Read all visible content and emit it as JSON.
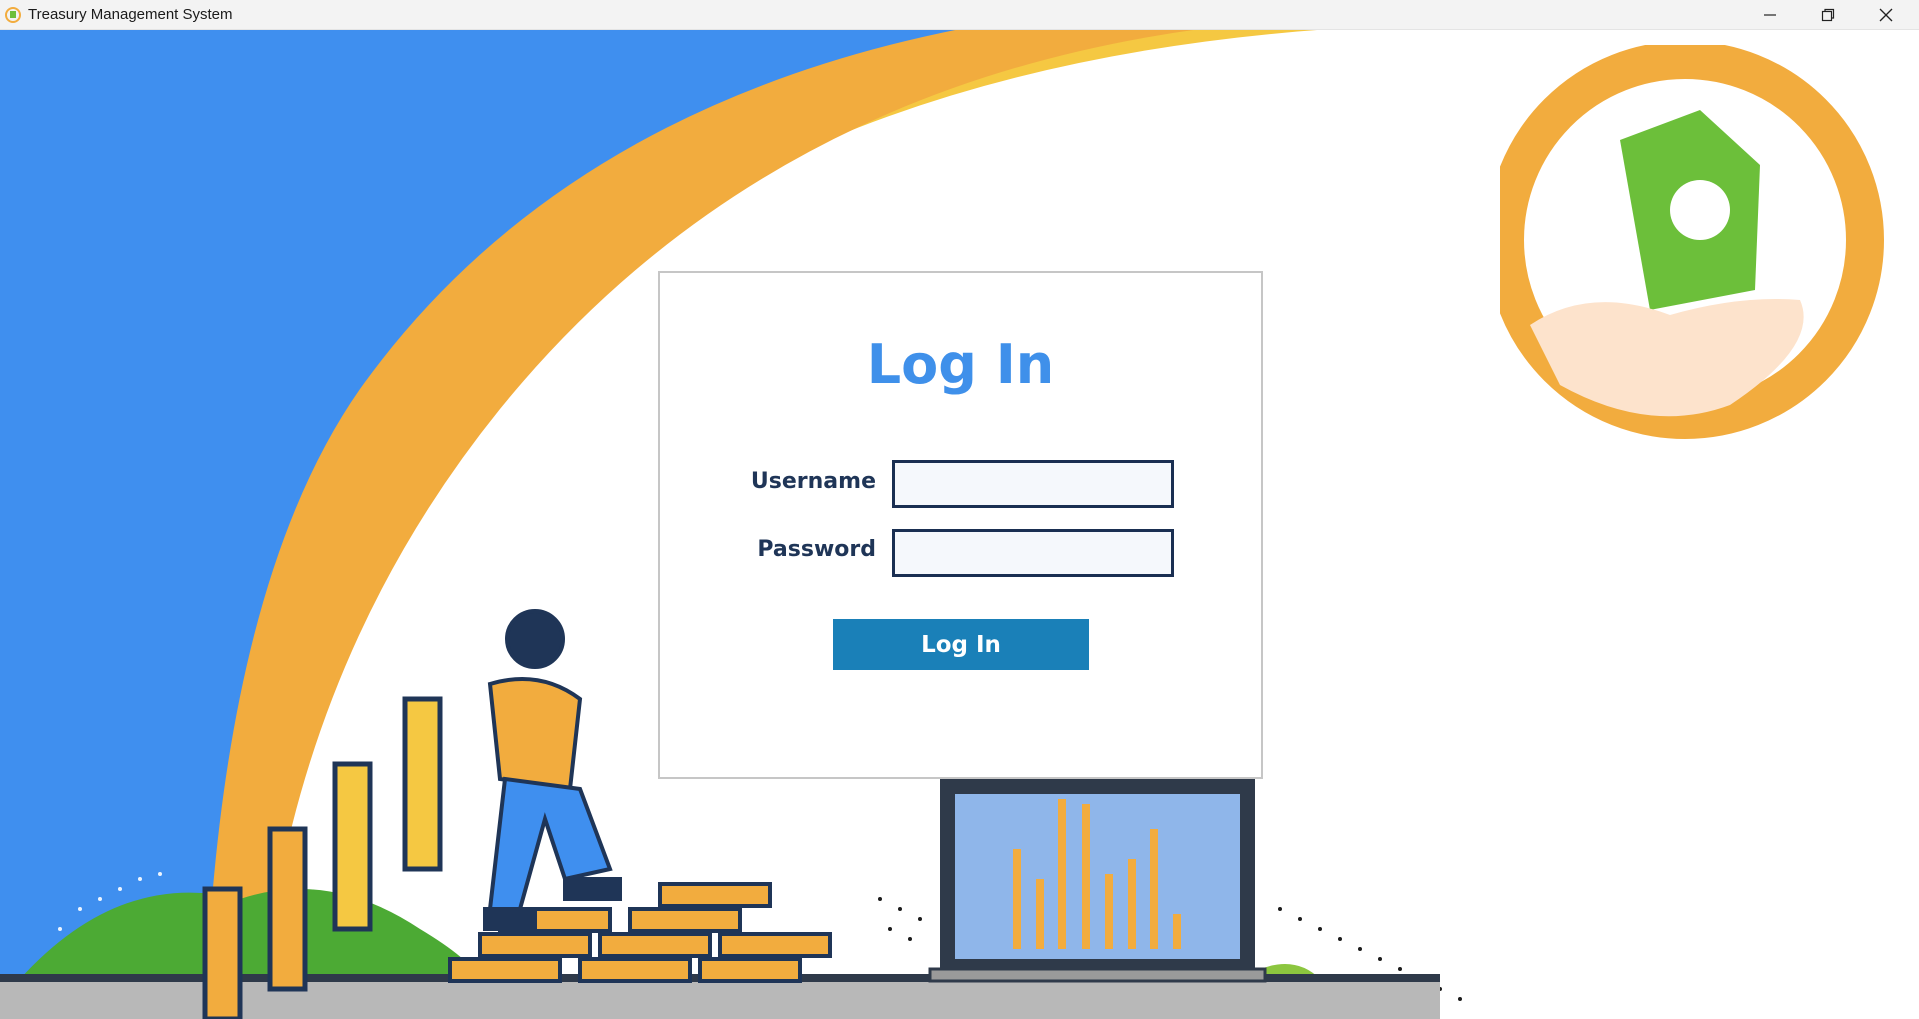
{
  "window": {
    "title": "Treasury Management System",
    "controls": {
      "minimize": "minimize-icon",
      "maximize": "restore-icon",
      "close": "close-icon"
    }
  },
  "login": {
    "heading": "Log In",
    "username_label": "Username",
    "username_value": "",
    "password_label": "Password",
    "password_value": "",
    "submit_label": "Log In"
  },
  "colors": {
    "heading": "#3f90ea",
    "button": "#1a80b8",
    "label": "#1f3557",
    "bg_blue": "#3f8fef",
    "bg_orange": "#f2ac3e",
    "bg_yellow": "#f5c842"
  }
}
